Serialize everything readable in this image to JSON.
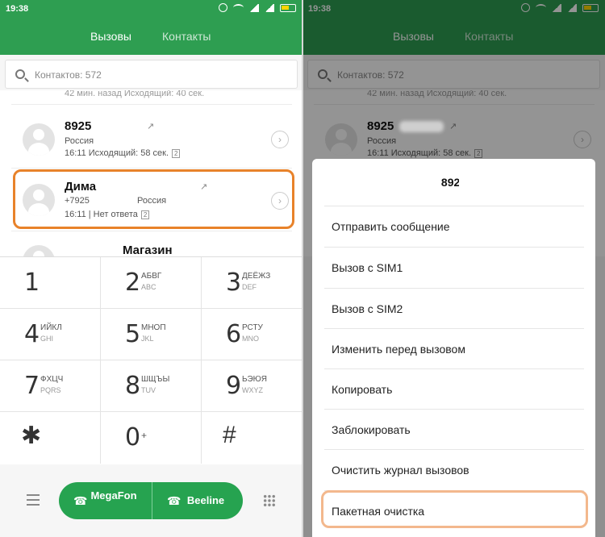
{
  "status_time": "19:38",
  "tabs": {
    "calls": "Вызовы",
    "contacts": "Контакты"
  },
  "search": {
    "placeholder": "Контактов: 572"
  },
  "partial_row_text": "42 мин. назад Исходящий: 40 сек.",
  "calls": [
    {
      "name": "8925",
      "line1": "Россия",
      "line2": "16:11 Исходящий: 58 сек.",
      "sim": "2"
    },
    {
      "name": "Дима",
      "number": "+7925",
      "region": "Россия",
      "line2": "16:11 | Нет ответа",
      "sim": "2"
    },
    {
      "name": "Магазин"
    }
  ],
  "keypad": [
    {
      "digit": "1",
      "letters": "",
      "latin": ""
    },
    {
      "digit": "2",
      "letters": "АБВГ",
      "latin": "ABC"
    },
    {
      "digit": "3",
      "letters": "ДЕЁЖЗ",
      "latin": "DEF"
    },
    {
      "digit": "4",
      "letters": "ИЙКЛ",
      "latin": "GHI"
    },
    {
      "digit": "5",
      "letters": "МНОП",
      "latin": "JKL"
    },
    {
      "digit": "6",
      "letters": "РСТУ",
      "latin": "MNO"
    },
    {
      "digit": "7",
      "letters": "ФХЦЧ",
      "latin": "PQRS"
    },
    {
      "digit": "8",
      "letters": "ШЩЪЫ",
      "latin": "TUV"
    },
    {
      "digit": "9",
      "letters": "ЬЭЮЯ",
      "latin": "WXYZ"
    }
  ],
  "keypad_bottom": {
    "star": "✱",
    "zero": "0",
    "plus": "+",
    "hash": "#"
  },
  "call_buttons": {
    "sim1": "MegaFon",
    "sim2": "Beeline"
  },
  "icons": {
    "phone": "☎"
  },
  "sheet": {
    "title": "8925",
    "items": [
      "Отправить сообщение",
      "Вызов с SIM1",
      "Вызов с SIM2",
      "Изменить перед вызовом",
      "Копировать",
      "Заблокировать",
      "Очистить журнал вызовов",
      "Пакетная очистка"
    ]
  },
  "colors": {
    "accent": "#2e9e51",
    "call_button": "#26a350",
    "highlight": "#e8822a"
  }
}
